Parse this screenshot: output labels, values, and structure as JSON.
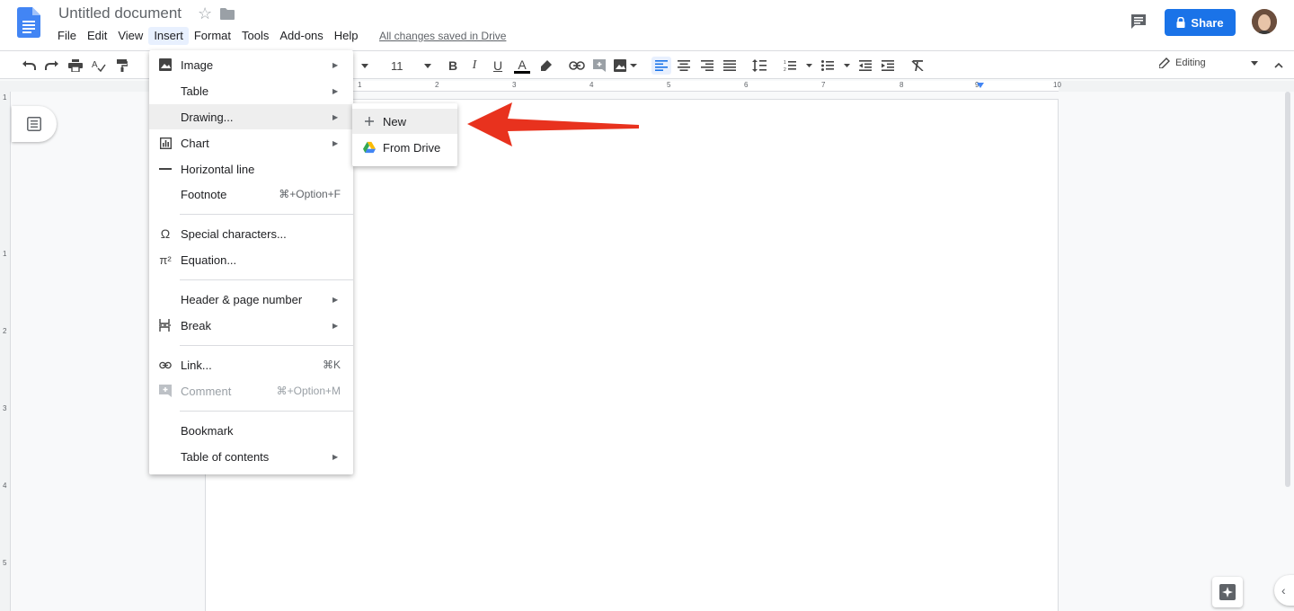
{
  "header": {
    "doc_title": "Untitled document",
    "saved_status": "All changes saved in Drive",
    "share_label": "Share",
    "menus": [
      "File",
      "Edit",
      "View",
      "Insert",
      "Format",
      "Tools",
      "Add-ons",
      "Help"
    ],
    "active_menu": "Insert"
  },
  "toolbar": {
    "font_size": "11",
    "editing_mode": "Editing"
  },
  "ruler": {
    "marks": [
      "1",
      "2",
      "3",
      "4",
      "5",
      "6",
      "7",
      "8",
      "9",
      "10"
    ],
    "vertical_marks": [
      "1",
      "1",
      "2",
      "3",
      "4",
      "5"
    ]
  },
  "insert_menu": {
    "items": [
      {
        "label": "Image",
        "icon": "image-icon",
        "submenu": true
      },
      {
        "label": "Table",
        "submenu": true
      },
      {
        "label": "Drawing...",
        "submenu": true,
        "highlighted": true
      },
      {
        "label": "Chart",
        "icon": "chart-icon",
        "submenu": true
      },
      {
        "label": "Horizontal line",
        "icon": "horizontal-line-icon"
      },
      {
        "label": "Footnote",
        "shortcut": "⌘+Option+F"
      },
      {
        "label": "Special characters...",
        "icon": "omega-icon"
      },
      {
        "label": "Equation...",
        "icon": "pi-icon"
      },
      {
        "label": "Header & page number",
        "submenu": true
      },
      {
        "label": "Break",
        "icon": "page-break-icon",
        "submenu": true
      },
      {
        "label": "Link...",
        "icon": "link-icon",
        "shortcut": "⌘K"
      },
      {
        "label": "Comment",
        "icon": "comment-add-icon",
        "shortcut": "⌘+Option+M",
        "disabled": true
      },
      {
        "label": "Bookmark"
      },
      {
        "label": "Table of contents",
        "submenu": true
      }
    ]
  },
  "drawing_submenu": {
    "items": [
      {
        "label": "New",
        "icon": "plus-icon"
      },
      {
        "label": "From Drive",
        "icon": "google-drive-icon"
      }
    ]
  },
  "colors": {
    "accent": "#1a73e8",
    "annotation_arrow": "#e8321e",
    "menu_hover": "#eeeeee"
  }
}
